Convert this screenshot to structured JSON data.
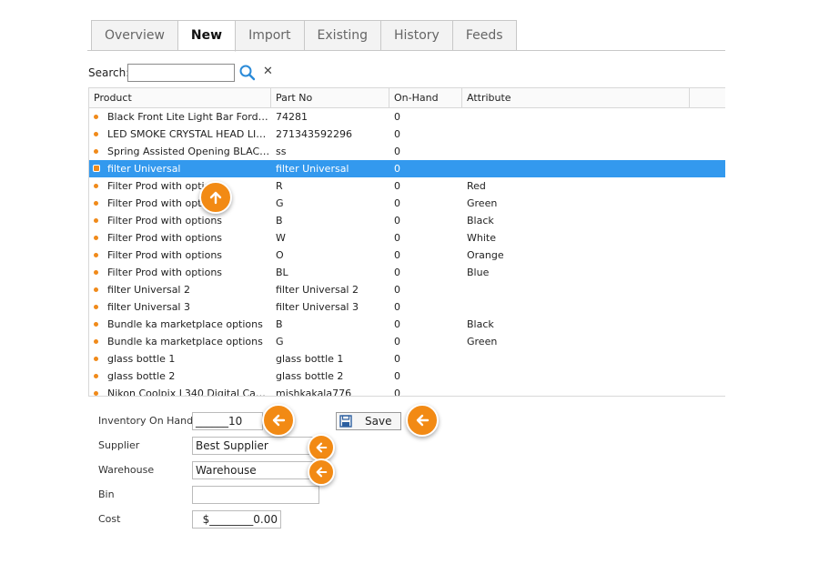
{
  "tabs": [
    "Overview",
    "New",
    "Import",
    "Existing",
    "History",
    "Feeds"
  ],
  "active_tab": "New",
  "search": {
    "label": "Search:",
    "value": ""
  },
  "grid": {
    "columns": [
      "Product",
      "Part No",
      "On-Hand",
      "Attribute"
    ],
    "rows": [
      {
        "product": "Black Front Lite Light Bar Ford F1...",
        "part": "74281",
        "onhand": "0",
        "attr": ""
      },
      {
        "product": "LED SMOKE CRYSTAL HEAD LIGH...",
        "part": "271343592296",
        "onhand": "0",
        "attr": ""
      },
      {
        "product": "Spring Assisted Opening BLACK T...",
        "part": "ss",
        "onhand": "0",
        "attr": ""
      },
      {
        "product": "filter Universal",
        "part": "filter Universal",
        "onhand": "0",
        "attr": ""
      },
      {
        "product": "Filter Prod with options",
        "part": "R",
        "onhand": "0",
        "attr": "Red"
      },
      {
        "product": "Filter Prod with options",
        "part": "G",
        "onhand": "0",
        "attr": "Green"
      },
      {
        "product": "Filter Prod with options",
        "part": "B",
        "onhand": "0",
        "attr": "Black"
      },
      {
        "product": "Filter Prod with options",
        "part": "W",
        "onhand": "0",
        "attr": "White"
      },
      {
        "product": "Filter Prod with options",
        "part": "O",
        "onhand": "0",
        "attr": "Orange"
      },
      {
        "product": "Filter Prod with options",
        "part": "BL",
        "onhand": "0",
        "attr": "Blue"
      },
      {
        "product": "filter Universal 2",
        "part": "filter Universal 2",
        "onhand": "0",
        "attr": ""
      },
      {
        "product": "filter Universal 3",
        "part": "filter Universal 3",
        "onhand": "0",
        "attr": ""
      },
      {
        "product": "Bundle ka marketplace options",
        "part": "B",
        "onhand": "0",
        "attr": "Black"
      },
      {
        "product": "Bundle ka marketplace options",
        "part": "G",
        "onhand": "0",
        "attr": "Green"
      },
      {
        "product": "glass bottle 1",
        "part": "glass bottle 1",
        "onhand": "0",
        "attr": ""
      },
      {
        "product": "glass bottle 2",
        "part": "glass bottle 2",
        "onhand": "0",
        "attr": ""
      },
      {
        "product": "Nikon Coolpix L340 Digital Camer...",
        "part": "mishkakala776",
        "onhand": "0",
        "attr": ""
      }
    ],
    "selected_index": 3
  },
  "form": {
    "inventory_label": "Inventory On Hand",
    "inventory_value": "______10",
    "supplier_label": "Supplier",
    "supplier_value": "Best Supplier",
    "warehouse_label": "Warehouse",
    "warehouse_value": "Warehouse",
    "bin_label": "Bin",
    "bin_value": "",
    "cost_label": "Cost",
    "cost_value": "$________0.00"
  },
  "save_label": "Save",
  "colors": {
    "accent": "#f28a14",
    "selection": "#3399ee"
  },
  "icons": [
    "search-icon",
    "clear-icon",
    "floppy-disk-icon",
    "arrow-left-icon",
    "arrow-up-icon"
  ]
}
